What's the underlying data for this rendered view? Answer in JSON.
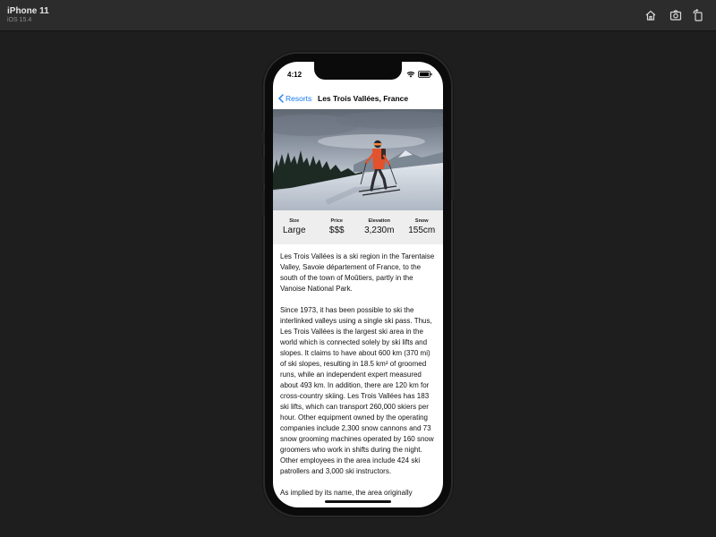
{
  "simulator": {
    "device_name": "iPhone 11",
    "os_version": "iOS 15.4",
    "buttons": [
      "home-icon",
      "screenshot-icon",
      "rotate-icon"
    ]
  },
  "status_bar": {
    "time": "4:12",
    "icons": [
      "wifi-icon",
      "battery-icon"
    ]
  },
  "nav": {
    "back_label": "Resorts",
    "title": "Les Trois Vallées, France"
  },
  "stats": [
    {
      "label": "Size",
      "value": "Large"
    },
    {
      "label": "Price",
      "value": "$$$"
    },
    {
      "label": "Elevation",
      "value": "3,230m"
    },
    {
      "label": "Snow",
      "value": "155cm"
    }
  ],
  "description": [
    "Les Trois Vallées is a ski region in the Tarentaise Valley, Savoie département of France, to the south of the town of Moûtiers, partly in the Vanoise National Park.",
    "Since 1973, it has been possible to ski the interlinked valleys using a single ski pass. Thus, Les Trois Vallées is the largest ski area in the world which is connected solely by ski lifts and slopes. It claims to have about 600 km (370 mi) of ski slopes, resulting in 18.5 km² of groomed runs, while an independent expert measured about 493 km. In addition, there are 120 km for cross-country skiing. Les Trois Vallées has 183 ski lifts, which can transport 260,000 skiers per hour. Other equipment owned by the operating companies include 2,300 snow cannons and 73 snow grooming machines operated by 160 snow groomers who work in shifts during the night. Other employees in the area include 424 ski patrollers and 3,000 ski instructors.",
    "As implied by its name, the area originally"
  ],
  "colors": {
    "accent": "#1a7cf5",
    "stats_background": "#eeeeee",
    "simulator_background": "#1e1e1e"
  }
}
